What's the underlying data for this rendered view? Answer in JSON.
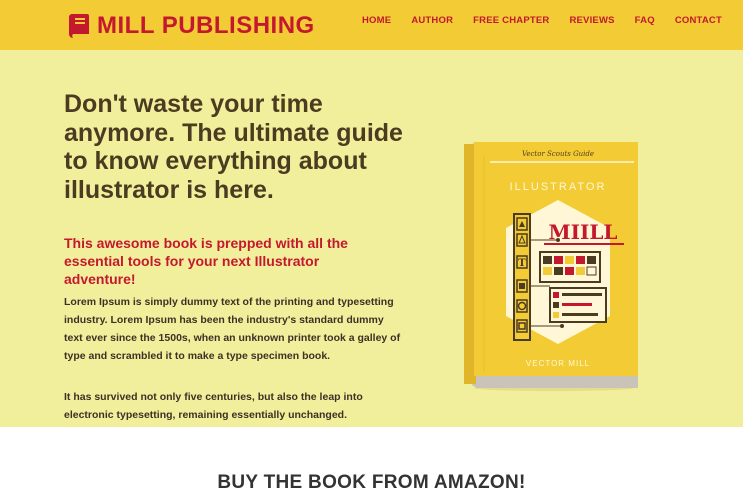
{
  "header": {
    "logo_text": "MILL PUBLISHING",
    "logo_icon": "book-icon",
    "nav": [
      {
        "label": "HOME"
      },
      {
        "label": "AUTHOR"
      },
      {
        "label": "FREE CHAPTER"
      },
      {
        "label": "REVIEWS"
      },
      {
        "label": "FAQ"
      },
      {
        "label": "CONTACT"
      }
    ]
  },
  "hero": {
    "headline": "Don't waste your time anymore. The ultimate guide to know everything about illustrator is here.",
    "subhead": "This awesome book is prepped with all the essential tools for your next Illustrator adventure!",
    "paragraph1": "Lorem Ipsum is simply dummy text of the printing and typesetting industry. Lorem Ipsum has been the industry's standard dummy text ever since the 1500s, when an unknown printer took a galley of type and scrambled it to make a type specimen book.",
    "paragraph2": "It has survived not only five centuries, but also the leap into electronic typesetting, remaining essentially unchanged."
  },
  "book": {
    "series": "Vector Scouts Guide",
    "title": "ILLUSTRATOR",
    "brand": "MIILL",
    "author": "VECTOR MILL"
  },
  "cta": {
    "title": "BUY THE BOOK FROM AMAZON!"
  },
  "colors": {
    "header_bg": "#f2cb35",
    "hero_bg": "#f2ef9c",
    "brand_red": "#c4182f",
    "text_dark": "#4a3b21"
  }
}
